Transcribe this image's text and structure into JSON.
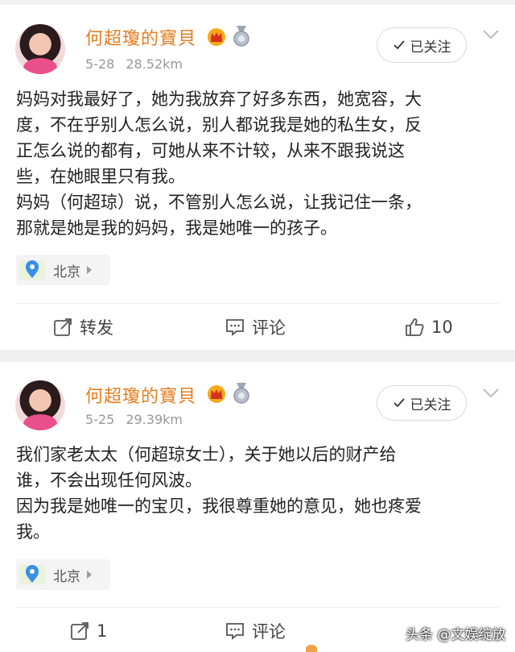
{
  "posts": [
    {
      "user": "何超瓊的寶貝",
      "date": "5-28",
      "distance": "28.52km",
      "follow_label": "已关注",
      "text": "妈妈对我最好了，她为我放弃了好多东西，她宽容，大\n度，不在乎别人怎么说，别人都说我是她的私生女，反\n正怎么说的都有，可她从来不计较，从来不跟我说这\n些，在她眼里只有我。\n妈妈（何超琼）说，不管别人怎么说，让我记住一条，\n那就是她是我的妈妈，我是她唯一的孩子。",
      "location": "北京",
      "repost_label": "转发",
      "comment_label": "评论",
      "like_count": "10"
    },
    {
      "user": "何超瓊的寶貝",
      "date": "5-25",
      "distance": "29.39km",
      "follow_label": "已关注",
      "text": "我们家老太太（何超琼女士），关于她以后的财产给\n谁，不会出现任何风波。\n因为我是她唯一的宝贝，我很尊重她的意见，她也疼爱\n我。",
      "location": "北京",
      "repost_count": "1",
      "comment_label": "评论"
    }
  ],
  "watermark": "头条 @文娱绽放",
  "colors": {
    "username": "#e67e22",
    "meta": "#999999",
    "separator": "#efefef"
  },
  "icons": [
    "avatar",
    "crown-badge-icon",
    "medal-badge-icon",
    "checkmark-icon",
    "chevron-down-icon",
    "location-pin-icon",
    "repost-icon",
    "comment-icon",
    "like-icon"
  ]
}
